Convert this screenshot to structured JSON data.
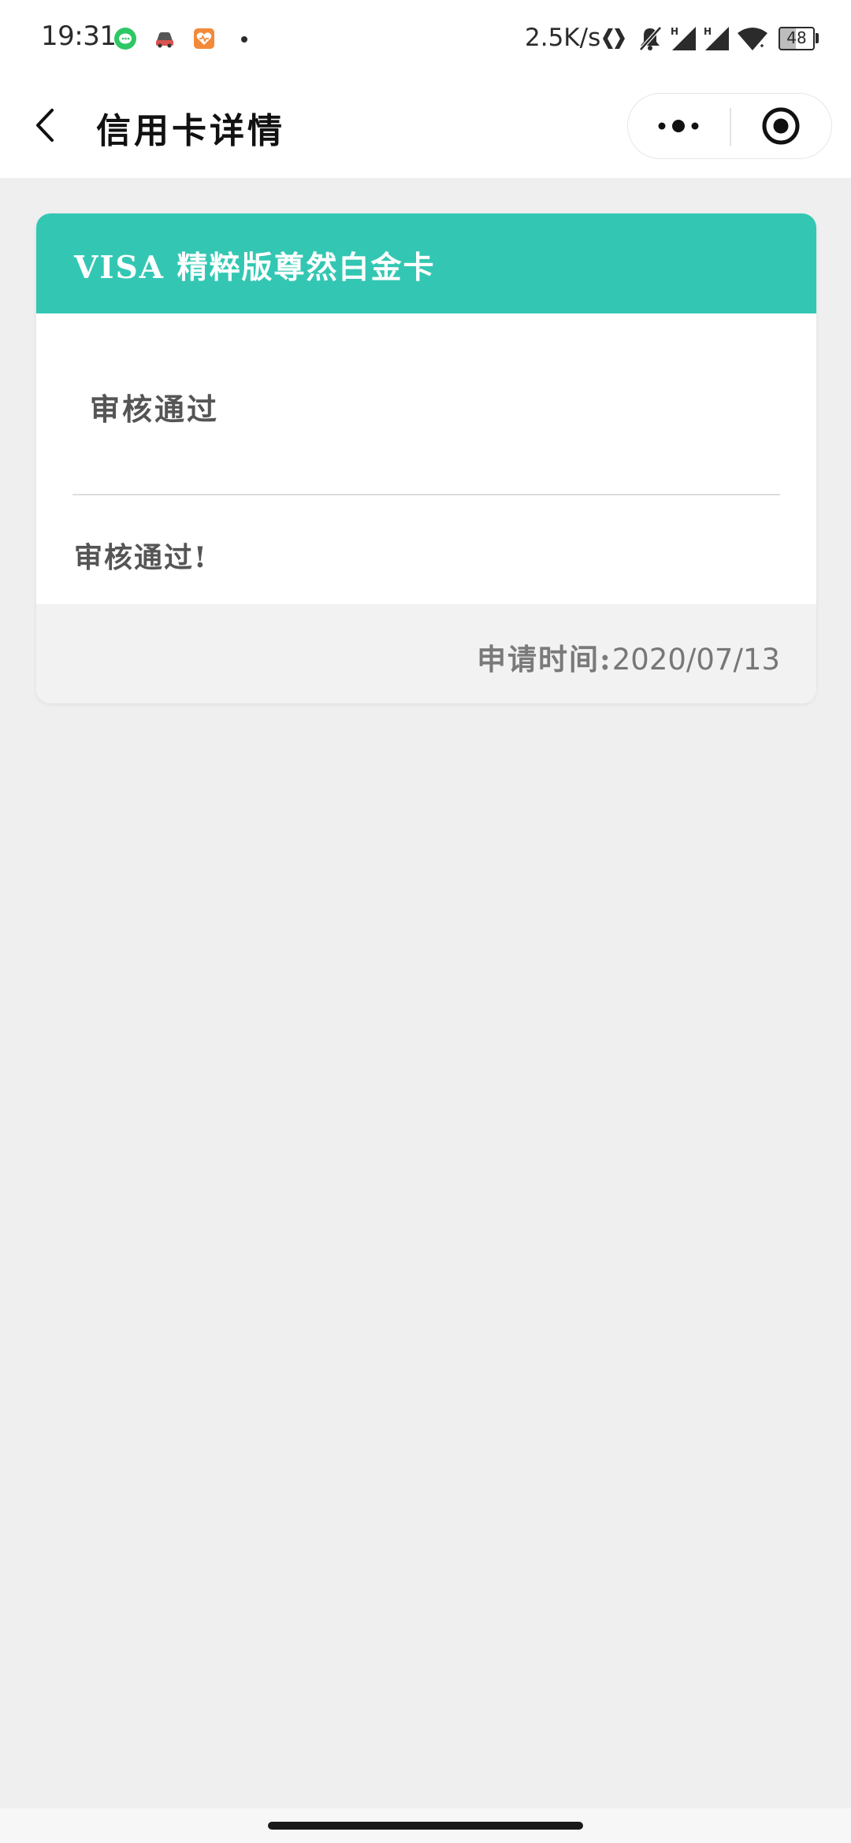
{
  "status_bar": {
    "time": "19:31",
    "network_speed": "2.5K/s",
    "battery_level": "48",
    "icons": [
      "wechat-icon",
      "car-app-icon",
      "heart-app-icon",
      "notification-dot",
      "nfc-icon",
      "mute-icon",
      "signal-h-icon",
      "signal-h-icon",
      "wifi-icon",
      "battery-icon"
    ]
  },
  "nav": {
    "title": "信用卡详情",
    "back_icon": "chevron-left-icon",
    "more_icon": "more-dots-icon",
    "close_icon": "target-close-icon"
  },
  "card": {
    "title": "VISA 精粹版尊然白金卡",
    "status_title": "审核通过",
    "status_message": "审核通过!",
    "apply_time_label": "申请时间:",
    "apply_time_value": "2020/07/13"
  },
  "colors": {
    "header_accent": "#33c7b3",
    "background": "#efefef",
    "card_footer": "#f2f2f2"
  }
}
